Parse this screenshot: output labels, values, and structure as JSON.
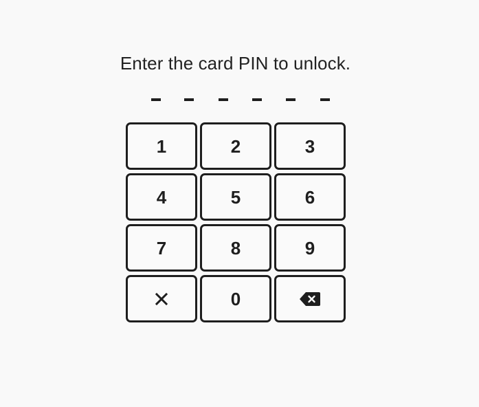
{
  "prompt": "Enter the card PIN to unlock.",
  "pin": {
    "length": 6,
    "entered": 0
  },
  "keypad": {
    "row1": [
      "1",
      "2",
      "3"
    ],
    "row2": [
      "4",
      "5",
      "6"
    ],
    "row3": [
      "7",
      "8",
      "9"
    ],
    "row4": {
      "clear_icon": "close-icon",
      "zero": "0",
      "backspace_icon": "backspace-icon"
    }
  },
  "colors": {
    "background": "#f9f9f9",
    "text": "#222222",
    "key_border": "#1e1e1e"
  }
}
